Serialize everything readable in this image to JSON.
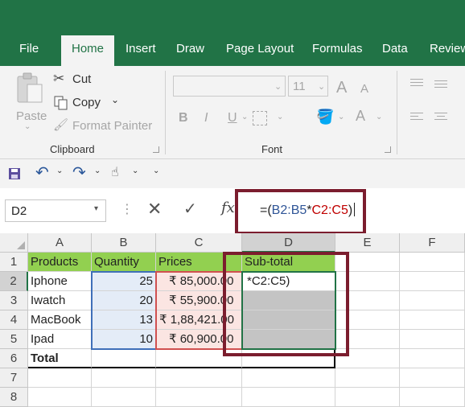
{
  "ribbon": {
    "tabs": [
      "File",
      "Home",
      "Insert",
      "Draw",
      "Page Layout",
      "Formulas",
      "Data",
      "Review"
    ],
    "active_tab": "Home",
    "clipboard": {
      "paste": "Paste",
      "cut": "Cut",
      "copy": "Copy",
      "format_painter": "Format Painter",
      "group_label": "Clipboard"
    },
    "font": {
      "size": "11",
      "bold": "B",
      "italic": "I",
      "underline": "U",
      "group_label": "Font"
    }
  },
  "formula_bar": {
    "name_box": "D2",
    "fx": "fx",
    "formula_prefix": "=(",
    "ref1": "B2:B5",
    "op": "*",
    "ref2": "C2:C5",
    "formula_suffix": ")"
  },
  "sheet": {
    "columns": [
      "A",
      "B",
      "C",
      "D",
      "E",
      "F"
    ],
    "rows": [
      "1",
      "2",
      "3",
      "4",
      "5",
      "6",
      "7",
      "8"
    ],
    "headers": [
      "Products",
      "Quantity",
      "Prices",
      "Sub-total"
    ],
    "data": [
      {
        "product": "Iphone",
        "qty": "25",
        "price": "₹ 85,000.00"
      },
      {
        "product": "Iwatch",
        "qty": "20",
        "price": "₹ 55,900.00"
      },
      {
        "product": "MacBook",
        "qty": "13",
        "price": "₹ 1,88,421.00"
      },
      {
        "product": "Ipad",
        "qty": "10",
        "price": "₹ 60,900.00"
      }
    ],
    "edit_text": "*C2:C5)",
    "total_label": "Total"
  },
  "colors": {
    "brand": "#217346",
    "header_fill": "#92d050",
    "quantity_ref": "#2f5597",
    "price_ref": "#c00000",
    "annotation": "#7b1d2e"
  }
}
